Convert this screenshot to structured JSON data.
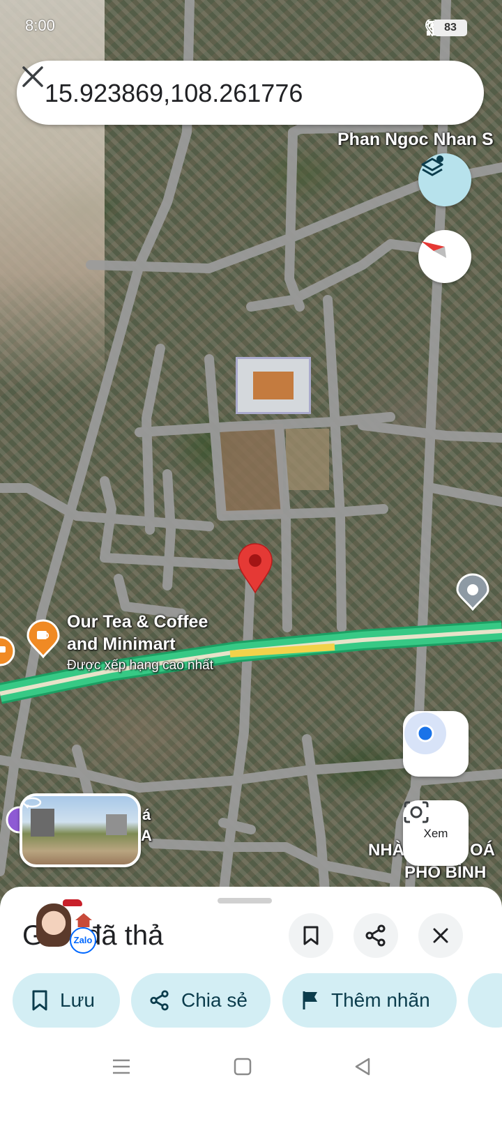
{
  "status_bar": {
    "time": "8:00",
    "battery": "83"
  },
  "search": {
    "query": "15.923869,108.261776"
  },
  "map": {
    "labels": {
      "top_street": "Phan Ngoc Nhan S",
      "poi_name_line1": "Our Tea & Coffee",
      "poi_name_line2": "and Minimart",
      "poi_subtitle": "Được xếp hạng cao nhất",
      "bottom_right_line1": "NHÀ",
      "bottom_right_line1b": "OÁ",
      "bottom_right_line2": "PHỐ BÌNH",
      "left_partial_line1": "á",
      "left_partial_line2": "A"
    },
    "icons": {
      "layers": "layers-icon",
      "compass": "compass-icon",
      "location": "my-location-icon",
      "lens": "lens-icon",
      "pin": "map-pin-icon",
      "poi": "coffee-cup-icon"
    },
    "xem_label": "Xem",
    "colors": {
      "pin": "#e53935",
      "poi": "#f08a24",
      "highway": "#2dbe7a",
      "highway_center": "#f2d24a",
      "road": "#9a9a9a",
      "location_dot": "#1a73e8"
    }
  },
  "sheet": {
    "title_prefix": "G",
    "title_rest": "đã thả",
    "zalo_badge": "Zalo",
    "chips": {
      "save": "Lưu",
      "share": "Chia sẻ",
      "label": "Thêm nhãn"
    }
  }
}
